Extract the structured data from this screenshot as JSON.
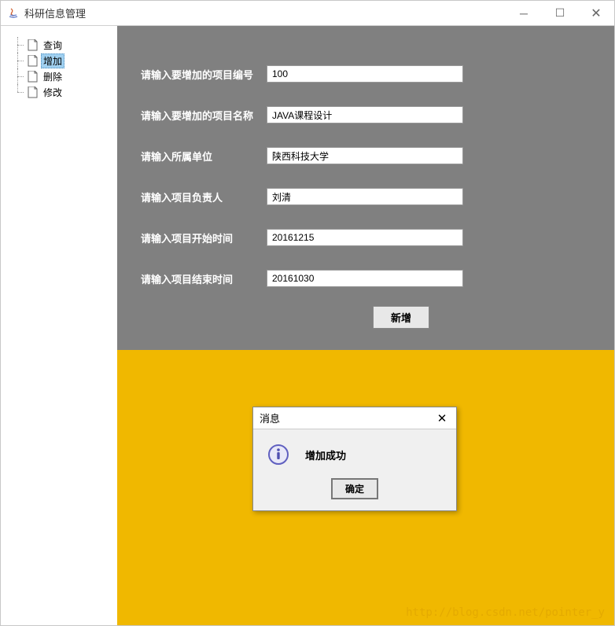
{
  "window": {
    "title": "科研信息管理"
  },
  "sidebar": {
    "items": [
      {
        "label": "查询",
        "selected": false
      },
      {
        "label": "增加",
        "selected": true
      },
      {
        "label": "删除",
        "selected": false
      },
      {
        "label": "修改",
        "selected": false
      }
    ]
  },
  "form": {
    "rows": [
      {
        "label": "请输入要增加的项目编号",
        "value": "100"
      },
      {
        "label": "请输入要增加的项目名称",
        "value": "JAVA课程设计"
      },
      {
        "label": "请输入所属单位",
        "value": "陕西科技大学"
      },
      {
        "label": "请输入项目负责人",
        "value": "刘清"
      },
      {
        "label": "请输入项目开始时间",
        "value": "20161215"
      },
      {
        "label": "请输入项目结束时间",
        "value": "20161030"
      }
    ],
    "submit_label": "新增"
  },
  "dialog": {
    "title": "消息",
    "message": "增加成功",
    "ok_label": "确定"
  },
  "watermark": "http://blog.csdn.net/pointer_y"
}
